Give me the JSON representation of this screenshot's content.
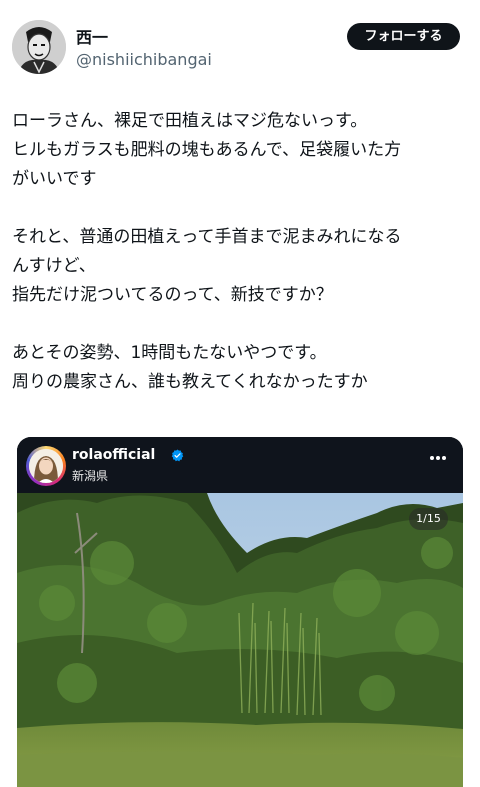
{
  "author": {
    "display_name": "西一",
    "handle": "@nishiichibangai",
    "follow_label": "フォローする"
  },
  "tweet": {
    "lines": [
      "ローラさん、裸足で田植えはマジ危ないっす。",
      "ヒルもガラスも肥料の塊もあるんで、足袋履いた方",
      "がいいです",
      "",
      "それと、普通の田植えって手首まで泥まみれになる",
      "んすけど、",
      "指先だけ泥ついてるのって、新技ですか？",
      "",
      "あとその姿勢、1時間もたないやつです。",
      "周りの農家さん、誰も教えてくれなかったすか"
    ]
  },
  "embed": {
    "username": "rolaofficial",
    "location": "新潟県",
    "page_counter": "1/15",
    "icons": {
      "verified": "verified-badge-icon",
      "more": "more-options-icon"
    }
  },
  "colors": {
    "follow_bg": "#0f1419",
    "verified": "#0095f6",
    "embed_bg": "#0f141c",
    "handle": "#536471"
  }
}
